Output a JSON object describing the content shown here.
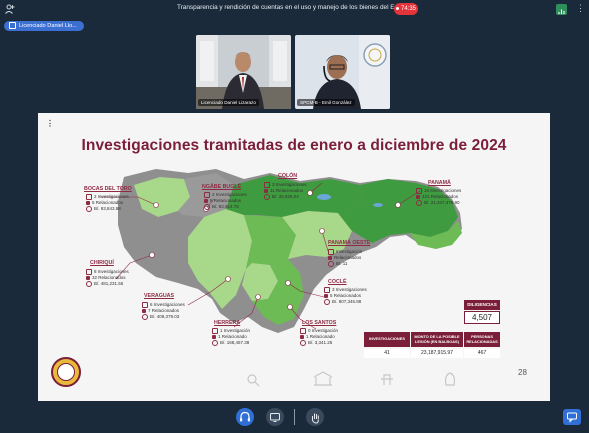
{
  "meeting": {
    "title": "Transparencia y rendición de cuentas en el uso y manejo de los bienes del Estado.",
    "timer": "74:35"
  },
  "presenter_chip": {
    "label": "Licenciado Daniel Llo..."
  },
  "participants": [
    {
      "name": "Licenciado Daniel Lizarazo"
    },
    {
      "name": "SPCM-B - Emil González"
    }
  ],
  "slide": {
    "title": "Investigaciones tramitadas de enero a diciembre de 2024",
    "page_number": "28",
    "provinces": [
      {
        "name": "BOCAS DEL TORO",
        "investigaciones": "2 Investigaciones",
        "relacionados": "5 Relacionados",
        "monto": "B/. 93,843.88"
      },
      {
        "name": "NGÄBE BUGLÉ",
        "investigaciones": "2 Investigaciones",
        "relacionados": "8 Relacionados",
        "monto": "B/. 83,914.75"
      },
      {
        "name": "COLÓN",
        "investigaciones": "3 Investigaciones",
        "relacionados": "11 Relacionados",
        "monto": "B/. 32,928.04"
      },
      {
        "name": "PANAMÁ",
        "investigaciones": "16 Investigaciones",
        "relacionados": "421 Relacionados",
        "monto": "B/. 21,347,476.90"
      },
      {
        "name": "PANAMÁ OESTE",
        "investigaciones": "Investigación",
        "relacionados": "Relacionados",
        "monto": "B/. 11"
      },
      {
        "name": "CHIRIQUÍ",
        "investigaciones": "8 Investigaciones",
        "relacionados": "32 Relacionados",
        "monto": "B/. 481,231.55"
      },
      {
        "name": "COCLÉ",
        "investigaciones": "3 Investigaciones",
        "relacionados": "5 Relacionados",
        "monto": "B/. 807,346.88"
      },
      {
        "name": "VERAGUAS",
        "investigaciones": "6 Investigaciones",
        "relacionados": "7 Relacionados",
        "monto": "B/. 409,379.03"
      },
      {
        "name": "HERRERA",
        "investigaciones": "1 Investigación",
        "relacionados": "1 Relacionado",
        "monto": "B/. 168,457.38"
      },
      {
        "name": "LOS SANTOS",
        "investigaciones": "0 Investigación",
        "relacionados": "1 Relacionado",
        "monto": "B/. 3,341.25"
      }
    ],
    "diligencias": {
      "label": "DILIGENCIAS",
      "value": "4,507"
    },
    "summary_table": {
      "headers": [
        "INVESTIGACIONES",
        "MONTO DE LA POSIBLE LESIÓN (EN BALBOAS)",
        "PERSONAS RELACIONADAS"
      ],
      "values": [
        "41",
        "23,187,915.97",
        "467"
      ]
    }
  },
  "colors": {
    "accent": "#7a1e3a",
    "map_dark": "#3f9b3f",
    "map_mid": "#6dbb54",
    "map_light": "#a8d88a",
    "map_gray": "#9a9a9a",
    "recording": "#e3333b",
    "control_blue": "#2f6fd6"
  },
  "icons": {
    "people": "person-icon",
    "stats": "bar-chart-icon",
    "more": "more-vert-icon",
    "audio": "headset-icon",
    "present": "screen-share-icon",
    "raise_hand": "hand-icon",
    "chat": "chat-icon"
  }
}
